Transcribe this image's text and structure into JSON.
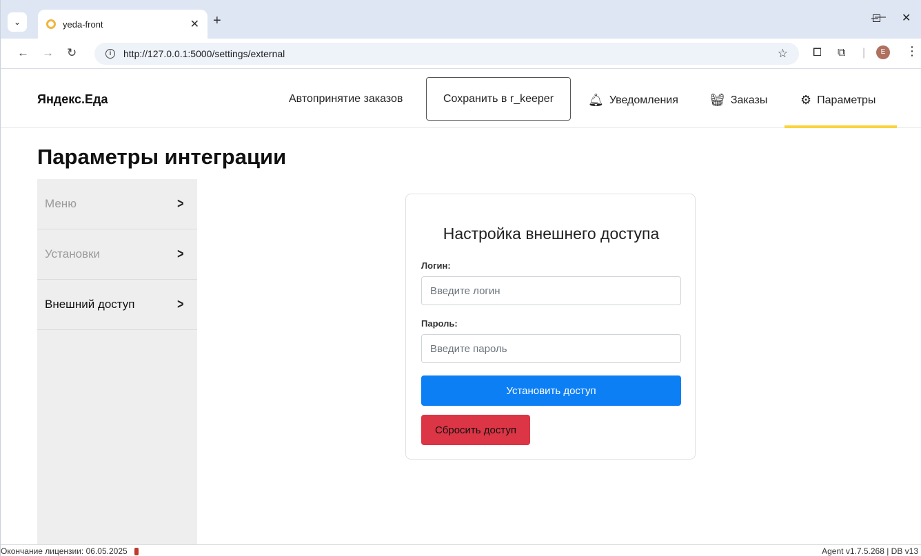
{
  "browser": {
    "tab_title": "yeda-front",
    "url": "http://127.0.0.1:5000/settings/external",
    "avatar_letter": "E",
    "icons": [
      "tab-search-icon",
      "close-icon",
      "plus-icon",
      "minimize-icon",
      "maximize-icon",
      "back-icon",
      "forward-icon",
      "reload-icon",
      "info-icon",
      "star-icon",
      "cast-icon",
      "extensions-icon",
      "menu-icon"
    ]
  },
  "navbar": {
    "brand": "Яндекс.Еда",
    "auto_accept": "Автопринятие заказов",
    "save_button": "Сохранить в r_keeper",
    "notifications": "Уведомления",
    "orders": "Заказы",
    "settings": "Параметры",
    "active_color": "#fbd33a"
  },
  "page": {
    "title": "Параметры интеграции"
  },
  "sidebar": {
    "items": [
      {
        "label": "Меню",
        "state": "muted"
      },
      {
        "label": "Установки",
        "state": "muted"
      },
      {
        "label": "Внешний доступ",
        "state": "active"
      }
    ]
  },
  "form": {
    "title": "Настройка внешнего доступа",
    "login_label": "Логин:",
    "login_placeholder": "Введите логин",
    "password_label": "Пароль:",
    "password_placeholder": "Введите пароль",
    "submit_button": "Установить доступ",
    "reset_button": "Сбросить доступ",
    "primary_color": "#0d7ff5",
    "danger_color": "#dc3545"
  },
  "footer": {
    "license": "Окончание лицензии: 06.05.2025",
    "version": "Agent v1.7.5.268  |  DB v13"
  }
}
